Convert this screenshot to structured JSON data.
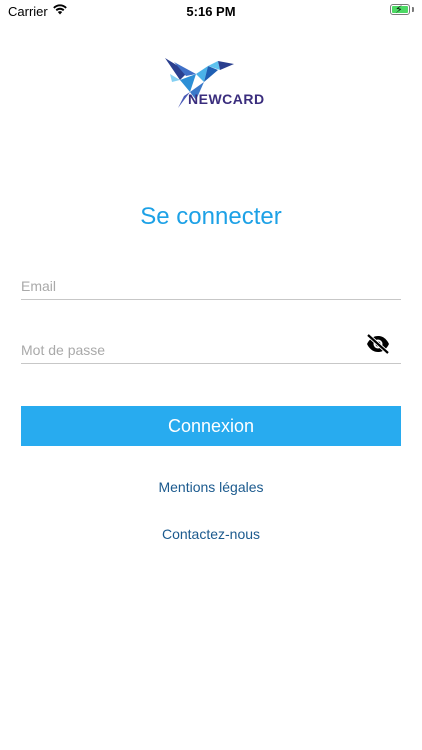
{
  "status_bar": {
    "carrier": "Carrier",
    "time": "5:16 PM",
    "wifi_icon": "wifi-icon",
    "battery_icon": "battery-charging-icon"
  },
  "brand": {
    "logo_text": "NEWCARD",
    "logo_icon": "hummingbird-logo",
    "color": "#3a2d7d"
  },
  "login": {
    "title": "Se connecter",
    "email_placeholder": "Email",
    "email_value": "",
    "password_placeholder": "Mot de passe",
    "password_value": "",
    "visibility_icon": "eye-off-icon",
    "submit_label": "Connexion"
  },
  "links": {
    "legal": "Mentions légales",
    "contact": "Contactez-nous"
  },
  "colors": {
    "accent": "#1da1e6",
    "button": "#28abef",
    "link": "#1b5a8e"
  }
}
